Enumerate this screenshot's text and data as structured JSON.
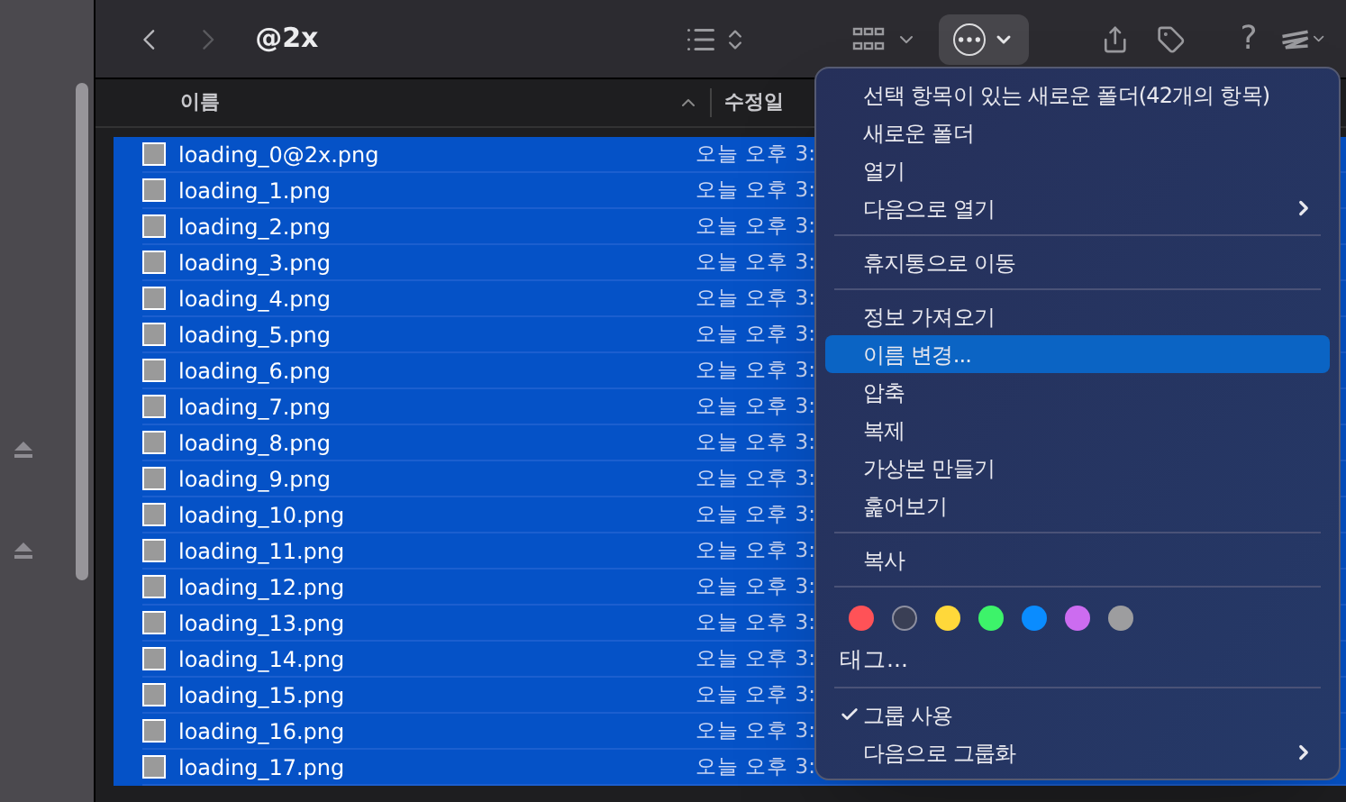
{
  "toolbar": {
    "title": "@2x",
    "back_enabled": true,
    "forward_enabled": false,
    "help": "?"
  },
  "columns": [
    {
      "label": "이름",
      "sorted": true
    },
    {
      "label": "수정일",
      "sorted": false
    }
  ],
  "rows": [
    {
      "name": "loading_0@2x.png",
      "modified": "오늘 오후 3:",
      "selected": true
    },
    {
      "name": "loading_1.png",
      "modified": "오늘 오후 3:",
      "selected": true
    },
    {
      "name": "loading_2.png",
      "modified": "오늘 오후 3:",
      "selected": true
    },
    {
      "name": "loading_3.png",
      "modified": "오늘 오후 3:",
      "selected": true
    },
    {
      "name": "loading_4.png",
      "modified": "오늘 오후 3:",
      "selected": true
    },
    {
      "name": "loading_5.png",
      "modified": "오늘 오후 3:",
      "selected": true
    },
    {
      "name": "loading_6.png",
      "modified": "오늘 오후 3:",
      "selected": true
    },
    {
      "name": "loading_7.png",
      "modified": "오늘 오후 3:",
      "selected": true
    },
    {
      "name": "loading_8.png",
      "modified": "오늘 오후 3:",
      "selected": true
    },
    {
      "name": "loading_9.png",
      "modified": "오늘 오후 3:",
      "selected": true
    },
    {
      "name": "loading_10.png",
      "modified": "오늘 오후 3:",
      "selected": true
    },
    {
      "name": "loading_11.png",
      "modified": "오늘 오후 3:",
      "selected": true
    },
    {
      "name": "loading_12.png",
      "modified": "오늘 오후 3:",
      "selected": true
    },
    {
      "name": "loading_13.png",
      "modified": "오늘 오후 3:",
      "selected": true
    },
    {
      "name": "loading_14.png",
      "modified": "오늘 오후 3:",
      "selected": true
    },
    {
      "name": "loading_15.png",
      "modified": "오늘 오후 3:",
      "selected": true
    },
    {
      "name": "loading_16.png",
      "modified": "오늘 오후 3:",
      "selected": true
    },
    {
      "name": "loading_17.png",
      "modified": "오늘 오후 3:",
      "selected": true
    }
  ],
  "menu": [
    {
      "kind": "item",
      "label": "선택 항목이 있는 새로운 폴더(42개의 항목)",
      "selected": false,
      "checked": false,
      "submenu": false
    },
    {
      "kind": "item",
      "label": "새로운 폴더",
      "selected": false,
      "checked": false,
      "submenu": false
    },
    {
      "kind": "item",
      "label": "열기",
      "selected": false,
      "checked": false,
      "submenu": false
    },
    {
      "kind": "item",
      "label": "다음으로 열기",
      "selected": false,
      "checked": false,
      "submenu": true
    },
    {
      "kind": "separator"
    },
    {
      "kind": "item",
      "label": "휴지통으로 이동",
      "selected": false,
      "checked": false,
      "submenu": false
    },
    {
      "kind": "separator"
    },
    {
      "kind": "item",
      "label": "정보 가져오기",
      "selected": false,
      "checked": false,
      "submenu": false
    },
    {
      "kind": "item",
      "label": "이름 변경...",
      "selected": true,
      "checked": false,
      "submenu": false
    },
    {
      "kind": "item",
      "label": "압축",
      "selected": false,
      "checked": false,
      "submenu": false
    },
    {
      "kind": "item",
      "label": "복제",
      "selected": false,
      "checked": false,
      "submenu": false
    },
    {
      "kind": "item",
      "label": "가상본 만들기",
      "selected": false,
      "checked": false,
      "submenu": false
    },
    {
      "kind": "item",
      "label": "훑어보기",
      "selected": false,
      "checked": false,
      "submenu": false
    },
    {
      "kind": "separator"
    },
    {
      "kind": "item",
      "label": "복사",
      "selected": false,
      "checked": false,
      "submenu": false
    },
    {
      "kind": "separator"
    },
    {
      "kind": "tags",
      "colors": [
        {
          "color": "#ff5257"
        },
        {
          "color": "#3a3f55",
          "outline": true
        },
        {
          "color": "#ffd83a"
        },
        {
          "color": "#3df36a"
        },
        {
          "color": "#0a8cff"
        },
        {
          "color": "#cc6cf0"
        },
        {
          "color": "#9d9d9f"
        }
      ]
    },
    {
      "kind": "tagitem",
      "label": "태그..."
    },
    {
      "kind": "separator"
    },
    {
      "kind": "item",
      "label": "그룹 사용",
      "selected": false,
      "checked": true,
      "submenu": false
    },
    {
      "kind": "item",
      "label": "다음으로 그룹화",
      "selected": false,
      "checked": false,
      "submenu": true
    }
  ]
}
